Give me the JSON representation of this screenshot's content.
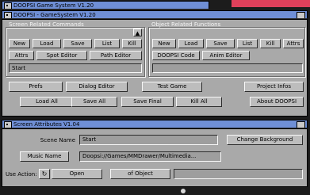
{
  "colors": {
    "background": "#1c1c1c",
    "titlebar_active": "#6f8fd6",
    "window": "#a9a9a9",
    "button": "#bdbdbd",
    "accent_pink": "#e0405b"
  },
  "back_window": {
    "title": "DOOPSI Game System V1.20"
  },
  "main_window": {
    "title": "DOOPSI - GameSystem V1.20",
    "screen_group": {
      "label": "Screen Related Commands",
      "buttons": [
        "New",
        "Load",
        "Save",
        "List",
        "Kill",
        "Attrs",
        "Spot Editor",
        "Path Editor"
      ],
      "list_value": "Start"
    },
    "object_group": {
      "label": "Object Related Functions",
      "buttons": [
        "New",
        "Load",
        "Save",
        "List",
        "Kill",
        "Attrs",
        "DOOPSI Code",
        "Anim Editor"
      ]
    },
    "bottom_row1": [
      "Prefs",
      "Dialog Editor",
      "Test Game",
      "Project Infos"
    ],
    "bottom_row2": [
      "Load All",
      "Save All",
      "Save Final",
      "Kill All",
      "About DOOPSI"
    ]
  },
  "screen_window": {
    "title": "Screen Attributes V1.04",
    "scene_name_label": "Scene Name",
    "scene_name_value": "Start",
    "change_bg_button": "Change Background",
    "music_name_button": "Music Name",
    "music_path": "Doopsi://Games/MMDrawer/Multimedia...",
    "use_action_label": "Use Action:",
    "cycle_icon": "cycle-gadget-icon",
    "open_value": "Open",
    "of_object_label": "of Object",
    "object_value": ""
  }
}
